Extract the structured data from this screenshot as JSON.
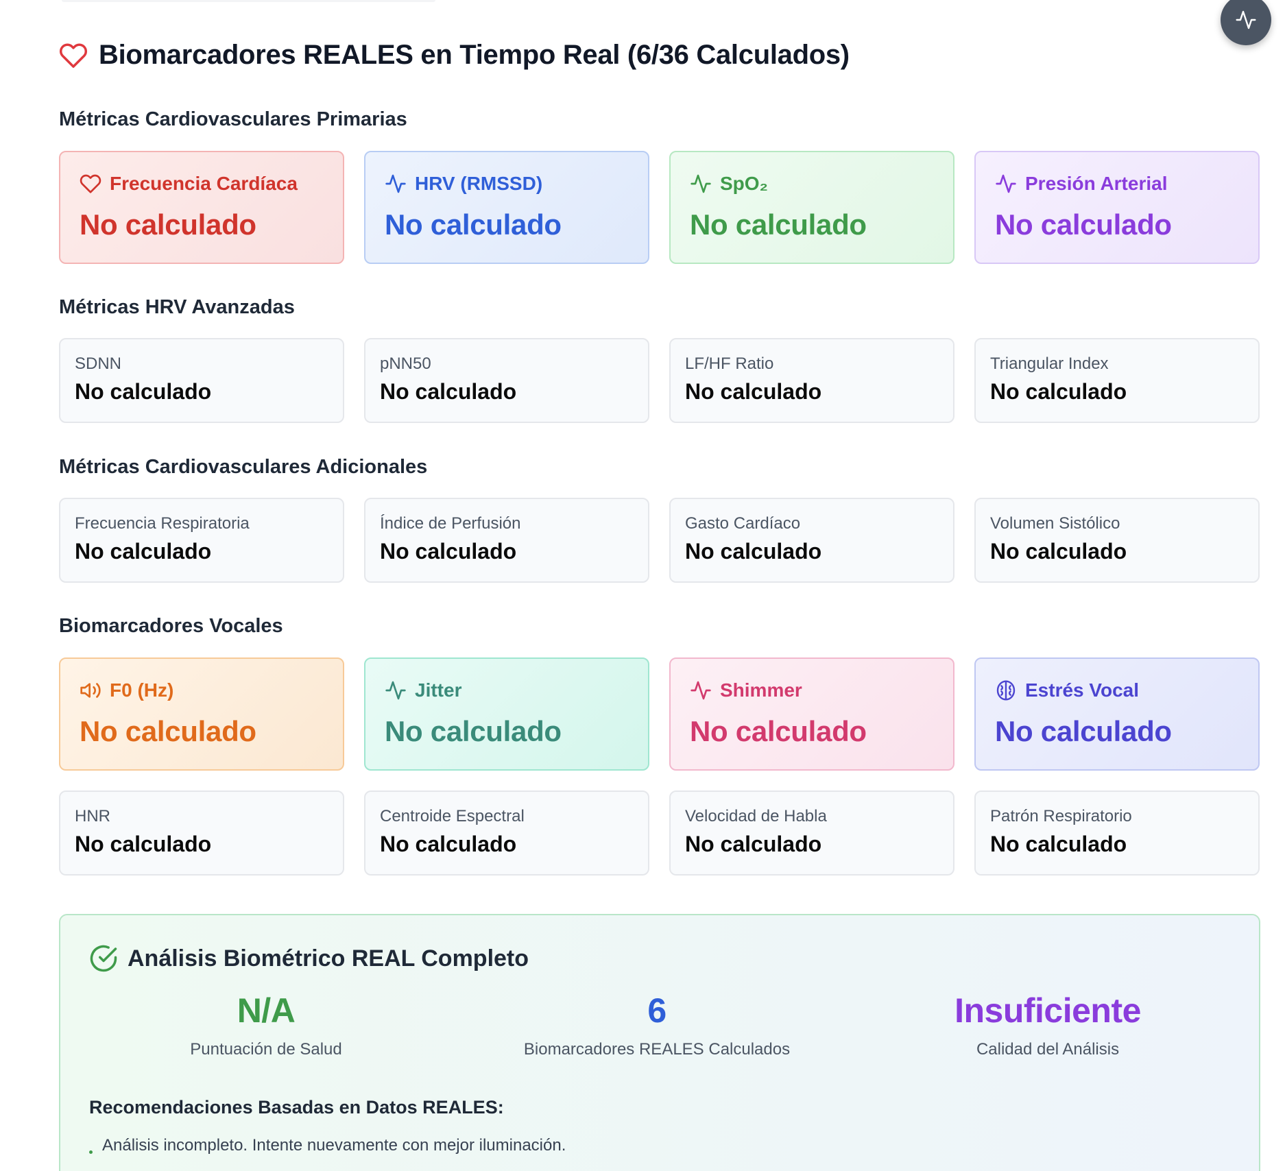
{
  "page": {
    "title": "Biomarcadores REALES en Tiempo Real (6/36 Calculados)"
  },
  "sections": {
    "primary_title": "Métricas Cardiovasculares Primarias",
    "hrv_title": "Métricas HRV Avanzadas",
    "additional_title": "Métricas Cardiovasculares Adicionales",
    "vocal_title": "Biomarcadores Vocales"
  },
  "primary": [
    {
      "label": "Frecuencia Cardíaca",
      "value": "No calculado",
      "icon": "heart-icon",
      "color": "#d0342c"
    },
    {
      "label": "HRV (RMSSD)",
      "value": "No calculado",
      "icon": "activity-icon",
      "color": "#2f5fd8"
    },
    {
      "label": "SpO₂",
      "value": "No calculado",
      "icon": "activity-icon",
      "color": "#3f9b4a"
    },
    {
      "label": "Presión Arterial",
      "value": "No calculado",
      "icon": "activity-icon",
      "color": "#8a3cdc"
    }
  ],
  "hrv": [
    {
      "label": "SDNN",
      "value": "No calculado"
    },
    {
      "label": "pNN50",
      "value": "No calculado"
    },
    {
      "label": "LF/HF Ratio",
      "value": "No calculado"
    },
    {
      "label": "Triangular Index",
      "value": "No calculado"
    }
  ],
  "additional": [
    {
      "label": "Frecuencia Respiratoria",
      "value": "No calculado"
    },
    {
      "label": "Índice de Perfusión",
      "value": "No calculado"
    },
    {
      "label": "Gasto Cardíaco",
      "value": "No calculado"
    },
    {
      "label": "Volumen Sistólico",
      "value": "No calculado"
    }
  ],
  "vocal": [
    {
      "label": "F0 (Hz)",
      "value": "No calculado",
      "icon": "volume-icon",
      "color": "#e06a1b"
    },
    {
      "label": "Jitter",
      "value": "No calculado",
      "icon": "activity-icon",
      "color": "#3a8b7a"
    },
    {
      "label": "Shimmer",
      "value": "No calculado",
      "icon": "activity-icon",
      "color": "#d23a6d"
    },
    {
      "label": "Estrés Vocal",
      "value": "No calculado",
      "icon": "brain-icon",
      "color": "#4b44d0"
    }
  ],
  "vocal_extra": [
    {
      "label": "HNR",
      "value": "No calculado"
    },
    {
      "label": "Centroide Espectral",
      "value": "No calculado"
    },
    {
      "label": "Velocidad de Habla",
      "value": "No calculado"
    },
    {
      "label": "Patrón Respiratorio",
      "value": "No calculado"
    }
  ],
  "summary": {
    "title": "Análisis Biométrico REAL Completo",
    "stats": [
      {
        "value": "N/A",
        "caption": "Puntuación de Salud",
        "color": "#3f9b4a"
      },
      {
        "value": "6",
        "caption": "Biomarcadores REALES Calculados",
        "color": "#2f5fd8"
      },
      {
        "value": "Insuficiente",
        "caption": "Calidad del Análisis",
        "color": "#8a3cdc"
      }
    ],
    "recommendations_title": "Recomendaciones Basadas en Datos REALES:",
    "recommendations": [
      "Análisis incompleto. Intente nuevamente con mejor iluminación."
    ]
  }
}
